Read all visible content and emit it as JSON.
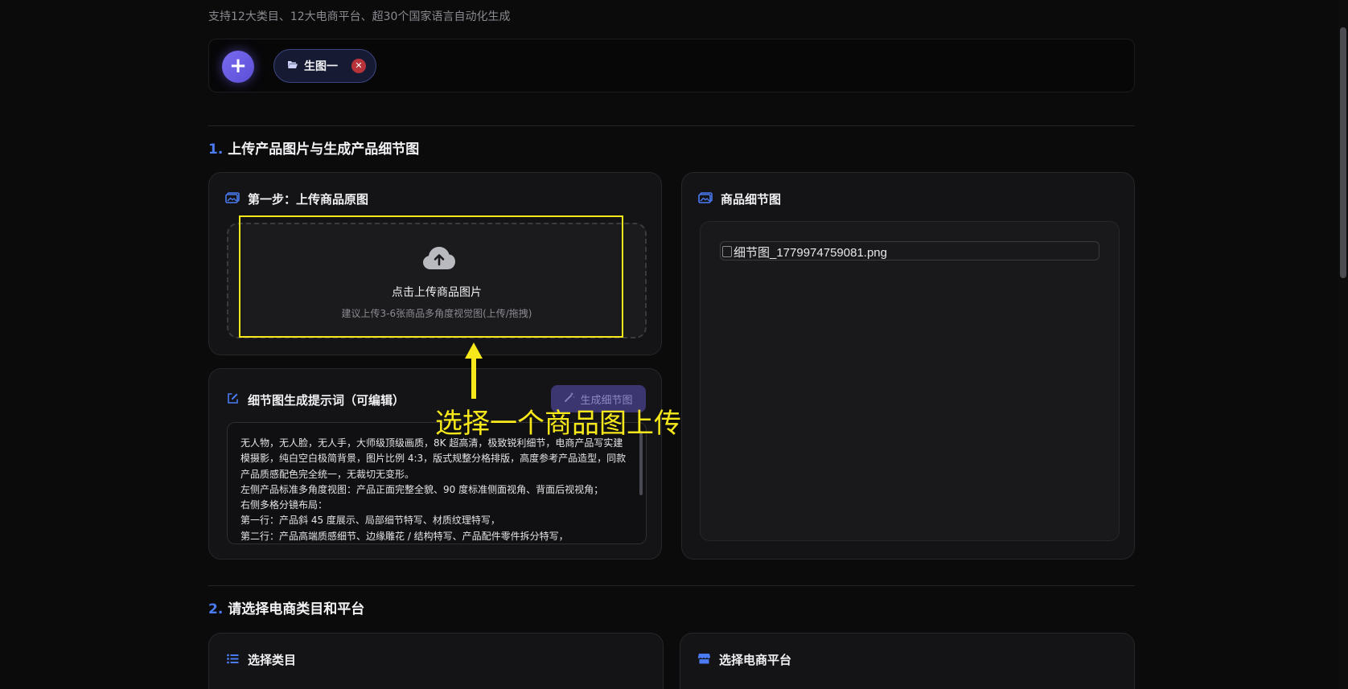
{
  "header": {
    "subtitle": "支持12大类目、12大电商平台、超30个国家语言自动化生成"
  },
  "tabs": {
    "add_label": "+",
    "items": [
      {
        "label": "生图一"
      }
    ]
  },
  "section1": {
    "num": "1.",
    "title": "上传产品图片与生成产品细节图",
    "upload_card": {
      "title": "第一步：上传商品原图",
      "main_text": "点击上传商品图片",
      "hint_text": "建议上传3-6张商品多角度视觉图(上传/拖拽)"
    },
    "prompt_card": {
      "title": "细节图生成提示词（可编辑）",
      "generate_label": "生成细节图",
      "lines": [
        "无人物，无人脸，无人手，大师级顶级画质，8K 超高清，极致锐利细节，电商产品写实建",
        "模摄影，纯白空白极简背景，图片比例 4:3，版式规整分格排版，高度参考产品造型，同款",
        "产品质感配色完全统一，无裁切无变形。",
        "左侧产品标准多角度视图：产品正面完整全貌、90 度标准侧面视角、背面后视视角；",
        "右侧多格分镜布局：",
        "第一行：产品斜 45 度展示、局部细节特写、材质纹理特写，",
        "第二行：产品高端质感细节、边缘雕花 / 结构特写、产品配件零件拆分特写，"
      ]
    },
    "detail_card": {
      "title": "商品细节图",
      "image_alt": "细节图_1779974759081.png"
    }
  },
  "section2": {
    "num": "2.",
    "title": "请选择电商类目和平台",
    "category_card": {
      "title": "选择类目"
    },
    "platform_card": {
      "title": "选择电商平台"
    }
  },
  "annotation": {
    "text": "选择一个商品图上传",
    "color": "#f6e81a"
  },
  "colors": {
    "accent": "#4a7bf2",
    "add_button": "#6b5ce6",
    "close_badge": "#b8323a",
    "background": "#0b0b0c"
  }
}
